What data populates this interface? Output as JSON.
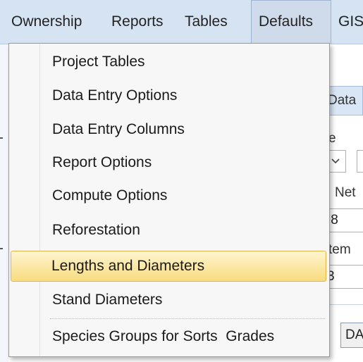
{
  "menubar": {
    "items": [
      "Ownership",
      "Reports",
      "Tables",
      "Defaults",
      "GIS"
    ],
    "active": "Defaults"
  },
  "dropdown": {
    "items": [
      {
        "label": "Project Tables"
      },
      {
        "label": "Data Entry Options"
      },
      {
        "label": "Data Entry Columns"
      },
      {
        "label": "Report Options"
      },
      {
        "label": "Compute Options"
      },
      {
        "label": "Reforestation"
      },
      {
        "label": "Lengths and Diameters"
      },
      {
        "label": "Stand Diameters"
      },
      {
        "label": "Species Groups for Sorts  Grades"
      }
    ],
    "highlighted": "Lengths and Diameters"
  },
  "background": {
    "tab_label": "Data",
    "label_e": "e",
    "label_net": "Net",
    "field_value_1": ".8",
    "label_item": "tem",
    "field_value_2": "3",
    "button_label": "DA"
  },
  "colors": {
    "menubar_bg": "#d6e3f3",
    "highlight_top": "#fff5cf",
    "highlight_bottom": "#f8dc7f",
    "highlight_border": "#e2b54a"
  }
}
